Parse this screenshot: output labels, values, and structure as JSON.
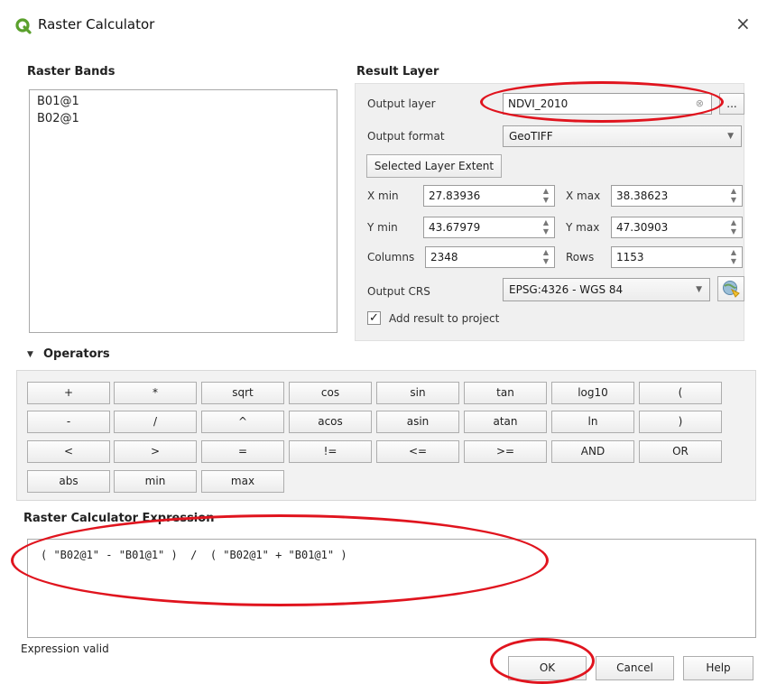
{
  "window": {
    "title": "Raster Calculator",
    "close_glyph": "×"
  },
  "bands": {
    "title": "Raster Bands",
    "items": [
      "B01@1",
      "B02@1"
    ]
  },
  "result": {
    "title": "Result Layer",
    "output_layer_label": "Output layer",
    "output_layer_value": "NDVI_2010",
    "browse_label": "...",
    "output_format_label": "Output format",
    "output_format_value": "GeoTIFF",
    "extent_button": "Selected Layer Extent",
    "xmin_label": "X min",
    "xmin_value": "27.83936",
    "xmax_label": "X max",
    "xmax_value": "38.38623",
    "ymin_label": "Y min",
    "ymin_value": "43.67979",
    "ymax_label": "Y max",
    "ymax_value": "47.30903",
    "columns_label": "Columns",
    "columns_value": "2348",
    "rows_label": "Rows",
    "rows_value": "1153",
    "crs_label": "Output CRS",
    "crs_value": "EPSG:4326 - WGS 84",
    "add_result_label": "Add result to project",
    "add_result_checked": true
  },
  "operators": {
    "title": "Operators",
    "rows": [
      [
        "+",
        "*",
        "sqrt",
        "cos",
        "sin",
        "tan",
        "log10",
        "("
      ],
      [
        "-",
        "/",
        "^",
        "acos",
        "asin",
        "atan",
        "ln",
        ")"
      ],
      [
        "<",
        ">",
        "=",
        "!=",
        "<=",
        ">=",
        "AND",
        "OR"
      ],
      [
        "abs",
        "min",
        "max"
      ]
    ]
  },
  "expression": {
    "title": "Raster Calculator Expression",
    "text": "( \"B02@1\" - \"B01@1\" )  /  ( \"B02@1\" + \"B01@1\" )",
    "status": "Expression valid"
  },
  "buttons": {
    "ok": "OK",
    "cancel": "Cancel",
    "help": "Help"
  },
  "colors": {
    "annotation": "#e0141e",
    "qgis_green": "#5aa02c"
  }
}
